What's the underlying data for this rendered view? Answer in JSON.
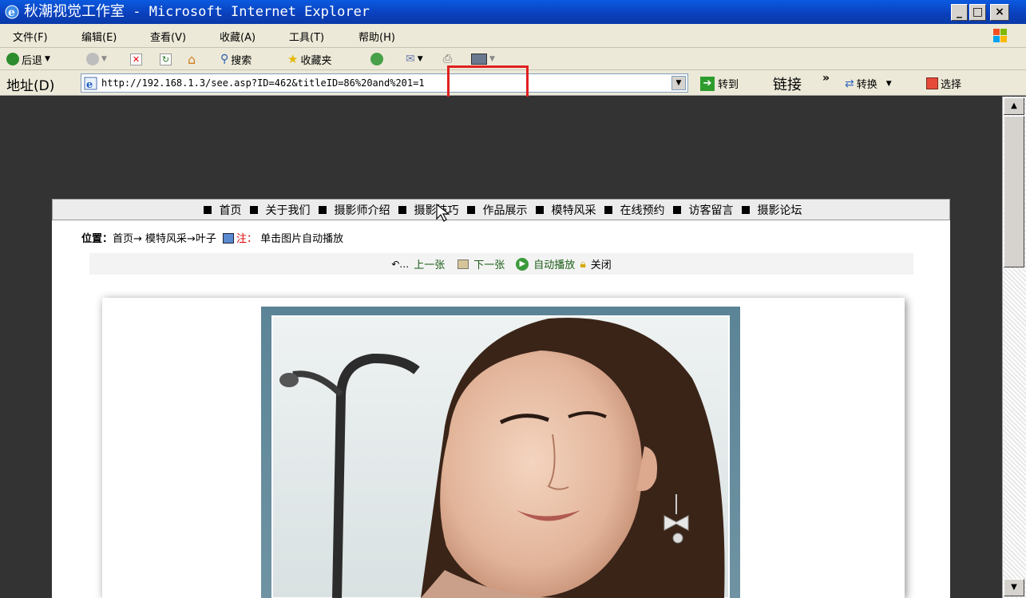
{
  "window": {
    "title": "秋潮视觉工作室",
    "title_suffix": " - Microsoft Internet Explorer",
    "minimize": "_",
    "maximize": "□",
    "close": "×"
  },
  "menu": [
    "文件(F)",
    "编辑(E)",
    "查看(V)",
    "收藏(A)",
    "工具(T)",
    "帮助(H)"
  ],
  "toolbar": {
    "back": "后退",
    "search": "搜索",
    "favorites": "收藏夹"
  },
  "address": {
    "label": "地址(D)",
    "url": "http://192.168.1.3/see.asp?ID=462&titleID=86%20and%201=1",
    "go": "转到",
    "links": "链接",
    "more": "»",
    "convert": "转换",
    "select": "选择"
  },
  "site": {
    "nav": [
      "首页",
      "关于我们",
      "摄影师介绍",
      "摄影技巧",
      "作品展示",
      "模特风采",
      "在线预约",
      "访客留言",
      "摄影论坛"
    ],
    "location_label": "位置：",
    "location_path": "首页→ 模特风采→叶子",
    "note_label": "注：",
    "note_text": "单击图片自动播放",
    "prev": "上一张",
    "next": "下一张",
    "autoplay": "自动播放",
    "close": "关闭"
  },
  "colors": {
    "title_bar": "#0a3fbb",
    "highlight_box": "#e02020",
    "nav_bg": "#ececec",
    "link_green": "#1a5d16"
  }
}
